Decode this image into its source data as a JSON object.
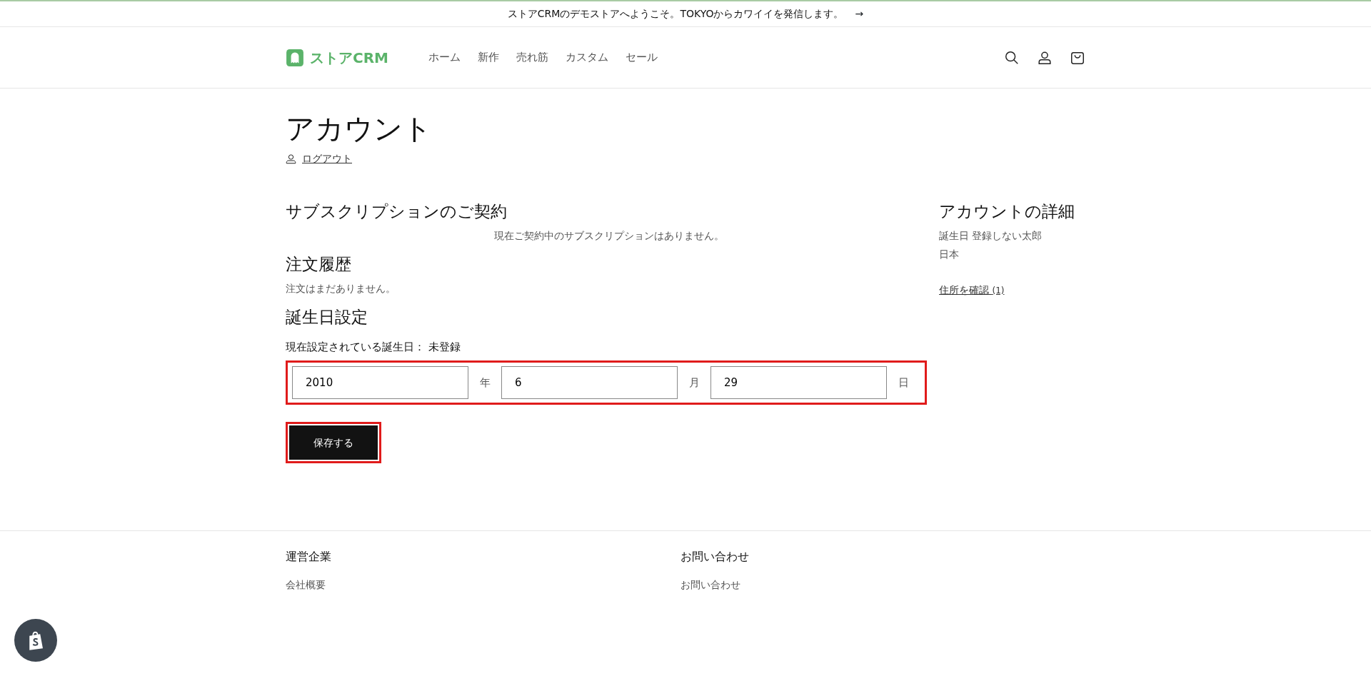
{
  "announcement": {
    "text": "ストアCRMのデモストアへようこそ。TOKYOからカワイイを発信します。",
    "arrow": "→"
  },
  "header": {
    "logo": "ストアCRM",
    "nav": [
      "ホーム",
      "新作",
      "売れ筋",
      "カスタム",
      "セール"
    ]
  },
  "page": {
    "title": "アカウント",
    "logout": "ログアウト"
  },
  "subscriptions": {
    "heading": "サブスクリプションのご契約",
    "message": "現在ご契約中のサブスクリプションはありません。"
  },
  "orders": {
    "heading": "注文履歴",
    "message": "注文はまだありません。"
  },
  "birthday": {
    "heading": "誕生日設定",
    "current": "現在設定されている誕生日： 未登録",
    "fields": [
      {
        "value": "2010",
        "unit": "年"
      },
      {
        "value": "6",
        "unit": "月"
      },
      {
        "value": "29",
        "unit": "日"
      }
    ],
    "save": "保存する"
  },
  "account_details": {
    "heading": "アカウントの詳細",
    "lines": [
      "誕生日 登録しない太郎",
      "日本"
    ],
    "addresses_link": "住所を確認",
    "addresses_count": "(1)"
  },
  "footer": {
    "columns": [
      {
        "heading": "運営企業",
        "links": [
          "会社概要"
        ]
      },
      {
        "heading": "お問い合わせ",
        "links": [
          "お問い合わせ"
        ]
      }
    ]
  }
}
